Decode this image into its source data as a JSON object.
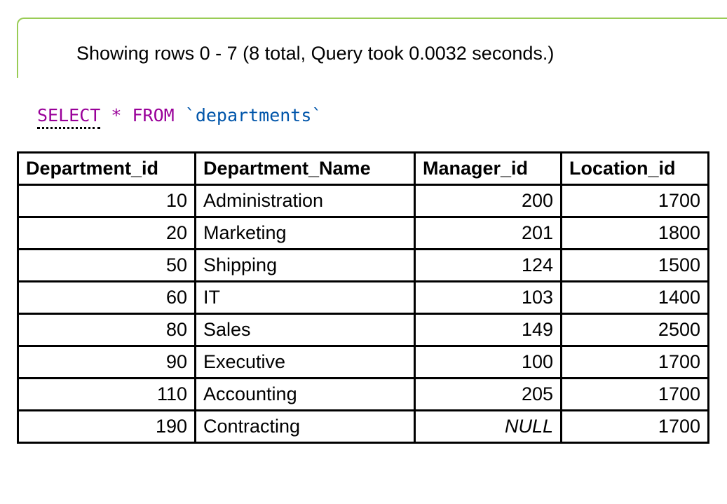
{
  "result": {
    "message": "Showing rows 0 - 7 (8 total, Query took 0.0032 seconds.)"
  },
  "query": {
    "select": "SELECT",
    "star": "*",
    "from": "FROM",
    "table": "`departments`"
  },
  "table": {
    "columns": [
      "Department_id",
      "Department_Name",
      "Manager_id",
      "Location_id"
    ],
    "rows": [
      {
        "department_id": "10",
        "department_name": "Administration",
        "manager_id": "200",
        "location_id": "1700"
      },
      {
        "department_id": "20",
        "department_name": "Marketing",
        "manager_id": "201",
        "location_id": "1800"
      },
      {
        "department_id": "50",
        "department_name": "Shipping",
        "manager_id": "124",
        "location_id": "1500"
      },
      {
        "department_id": "60",
        "department_name": "IT",
        "manager_id": "103",
        "location_id": "1400"
      },
      {
        "department_id": "80",
        "department_name": "Sales",
        "manager_id": "149",
        "location_id": "2500"
      },
      {
        "department_id": "90",
        "department_name": "Executive",
        "manager_id": "100",
        "location_id": "1700"
      },
      {
        "department_id": "110",
        "department_name": "Accounting",
        "manager_id": "205",
        "location_id": "1700"
      },
      {
        "department_id": "190",
        "department_name": "Contracting",
        "manager_id": "NULL",
        "location_id": "1700"
      }
    ]
  },
  "colors": {
    "success_border": "#99cc55",
    "sql_keyword": "#990099",
    "sql_identifier": "#0055aa"
  }
}
